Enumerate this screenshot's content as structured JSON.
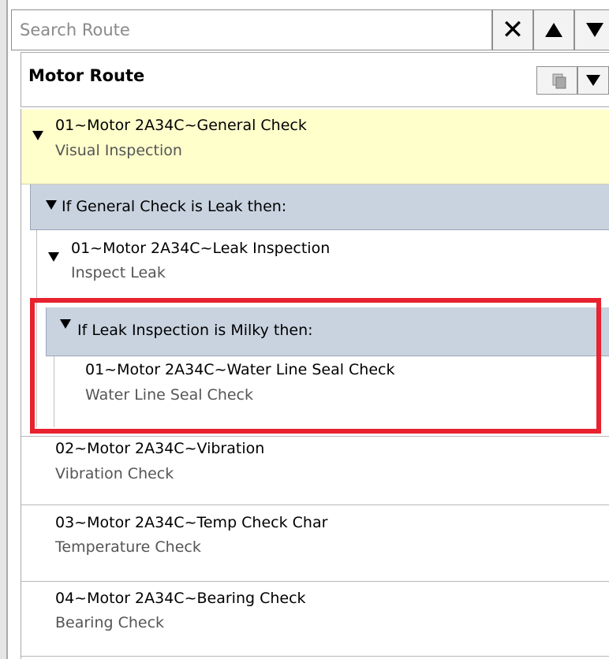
{
  "search": {
    "placeholder": "Search Route"
  },
  "route": {
    "title": "Motor Route"
  },
  "items": [
    {
      "title": "01~Motor 2A34C~General Check",
      "subtitle": "Visual Inspection"
    },
    {
      "title": "01~Motor 2A34C~Leak Inspection",
      "subtitle": "Inspect Leak"
    },
    {
      "title": "01~Motor 2A34C~Water Line Seal Check",
      "subtitle": "Water Line Seal Check"
    },
    {
      "title": "02~Motor 2A34C~Vibration",
      "subtitle": "Vibration Check"
    },
    {
      "title": "03~Motor 2A34C~Temp Check Char",
      "subtitle": "Temperature Check"
    },
    {
      "title": "04~Motor 2A34C~Bearing Check",
      "subtitle": "Bearing Check"
    }
  ],
  "conditions": [
    {
      "label": "If General Check is Leak then:"
    },
    {
      "label": "If Leak Inspection is Milky then:"
    }
  ],
  "icons": {
    "clear": "close-icon",
    "up": "arrow-up-icon",
    "down": "arrow-down-icon",
    "copy": "copy-icon",
    "menu": "dropdown-icon",
    "expand": "triangle-down-icon"
  },
  "colors": {
    "selected": "#ffffcc",
    "condition": "#c9d3e0",
    "highlight": "#e8222e"
  }
}
